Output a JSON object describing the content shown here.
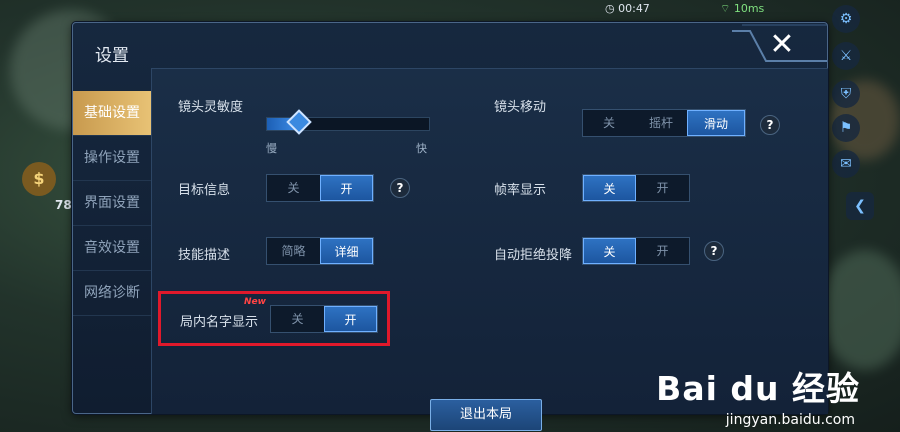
{
  "status_bar": {
    "time": "00:47",
    "ping": "10ms"
  },
  "hud": {
    "gold_value": "78"
  },
  "panel": {
    "title": "设置",
    "close_symbol": "✕"
  },
  "sidebar": {
    "items": [
      {
        "label": "基础设置",
        "active": true
      },
      {
        "label": "操作设置",
        "active": false
      },
      {
        "label": "界面设置",
        "active": false
      },
      {
        "label": "音效设置",
        "active": false
      },
      {
        "label": "网络诊断",
        "active": false
      }
    ]
  },
  "settings": {
    "camera_sensitivity": {
      "label": "镜头灵敏度",
      "min_label": "慢",
      "max_label": "快",
      "value": 0.2
    },
    "camera_move": {
      "label": "镜头移动",
      "options": [
        "关",
        "摇杆",
        "滑动"
      ],
      "selected": 2
    },
    "target_info": {
      "label": "目标信息",
      "options": [
        "关",
        "开"
      ],
      "selected": 1
    },
    "frame_rate": {
      "label": "帧率显示",
      "options": [
        "关",
        "开"
      ],
      "selected": 0
    },
    "skill_desc": {
      "label": "技能描述",
      "options": [
        "简略",
        "详细"
      ],
      "selected": 1
    },
    "auto_reject_surrender": {
      "label": "自动拒绝投降",
      "options": [
        "关",
        "开"
      ],
      "selected": 0
    },
    "in_game_names": {
      "label": "局内名字显示",
      "options": [
        "关",
        "开"
      ],
      "selected": 1,
      "badge": "New"
    }
  },
  "help_symbol": "?",
  "exit_button": {
    "label": "退出本局"
  },
  "watermark": {
    "brand": "Bai du 经验",
    "url": "jingyan.baidu.com"
  },
  "colors": {
    "accent_active_tab": "#e8c275",
    "selected_option": "#2e72c2",
    "highlight_box": "#e0192b"
  }
}
